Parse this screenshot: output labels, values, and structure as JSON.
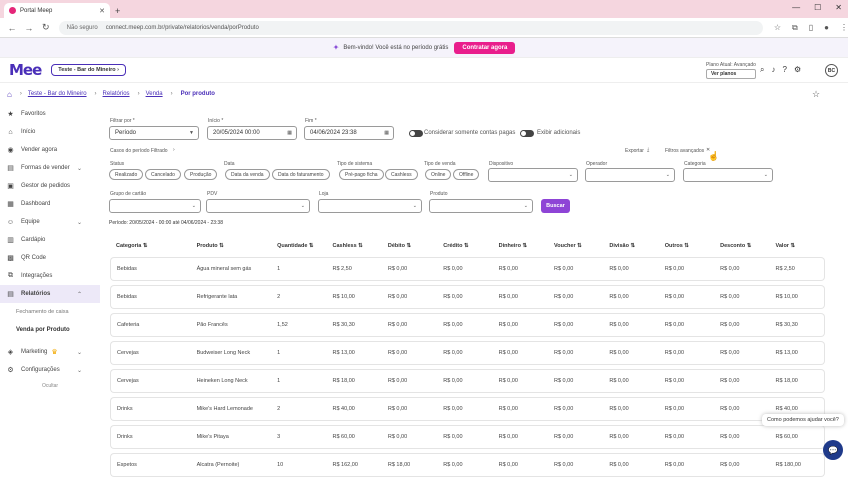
{
  "browser": {
    "tab_title": "Portal Meep",
    "new_tab": "+",
    "url_security": "Não seguro",
    "url": "connect.meep.com.br/private/relatorios/venda/porProduto"
  },
  "promo": {
    "text": "Bem-vindo! Você está no período grátis",
    "cta": "Contratar agora"
  },
  "app": {
    "logo": "Mee",
    "venue": "Teste - Bar do Mineiro",
    "plan_label": "Plano Atual: Avançado",
    "plan_button": "Ver planos",
    "avatar": "BC"
  },
  "breadcrumb": {
    "items": [
      "Teste - Bar do Mineiro",
      "Relatórios",
      "Venda"
    ],
    "current": "Por produto"
  },
  "sidebar": {
    "items": [
      {
        "label": "Favoritos",
        "icon": "★",
        "chevron": ""
      },
      {
        "label": "Início",
        "icon": "⌂",
        "chevron": ""
      },
      {
        "label": "Vender agora",
        "icon": "◉",
        "chevron": ""
      },
      {
        "label": "Formas de vender",
        "icon": "▤",
        "chevron": "⌄"
      },
      {
        "label": "Gestor de pedidos",
        "icon": "▣",
        "chevron": ""
      },
      {
        "label": "Dashboard",
        "icon": "▦",
        "chevron": ""
      },
      {
        "label": "Equipe",
        "icon": "☺",
        "chevron": "⌄"
      },
      {
        "label": "Cardápio",
        "icon": "▥",
        "chevron": ""
      },
      {
        "label": "QR Code",
        "icon": "▩",
        "chevron": ""
      },
      {
        "label": "Integrações",
        "icon": "⧉",
        "chevron": ""
      },
      {
        "label": "Relatórios",
        "icon": "▤",
        "chevron": "⌃"
      }
    ],
    "sub_items": [
      "Fechamento de caixa",
      "Venda por Produto"
    ],
    "bottom_items": [
      {
        "label": "Marketing",
        "icon": "◈",
        "chevron": "⌄"
      },
      {
        "label": "Configurações",
        "icon": "⚙",
        "chevron": "⌄"
      }
    ],
    "hide_label": "Ocultar"
  },
  "filters": {
    "filtrar_por_label": "Filtrar por *",
    "filtrar_por_value": "Período",
    "inicio_label": "Início *",
    "inicio_value": "20/05/2024 00:00",
    "fim_label": "Fim *",
    "fim_value": "04/06/2024 23:38",
    "toggle_pagas": "Considerar somente contas pagas",
    "toggle_adicionais": "Exibir adicionais",
    "period_cases": "Casos do período Filtrado",
    "exportar": "Exportar",
    "filtros_avancados": "Filtros avançados",
    "status_label": "Status",
    "status_chips": [
      "Realizado",
      "Cancelado",
      "Produção"
    ],
    "data_label": "Data",
    "data_chips": [
      "Data da venda",
      "Data do faturamento"
    ],
    "tipo_sistema_label": "Tipo de sistema",
    "tipo_sistema_chips": [
      "Pré-pago ficha",
      "Cashless"
    ],
    "tipo_venda_label": "Tipo de venda",
    "tipo_venda_chips": [
      "Online",
      "Offline"
    ],
    "dispositivo_label": "Dispositivo",
    "operador_label": "Operador",
    "categoria_label": "Categoria",
    "grupo_label": "Grupo de cartão",
    "pdv_label": "PDV",
    "loja_label": "Loja",
    "produto_label": "Produto",
    "buscar": "Buscar",
    "period_text": "Período: 20/05/2024 - 00:00 até 04/06/2024 - 23:38"
  },
  "table": {
    "headers": [
      "Categoria ⇅",
      "Produto ⇅",
      "Quantidade ⇅",
      "Cashless ⇅",
      "Débito ⇅",
      "Crédito ⇅",
      "Dinheiro ⇅",
      "Voucher ⇅",
      "Divisão ⇅",
      "Outros ⇅",
      "Desconto ⇅",
      "Valor ⇅"
    ],
    "rows": [
      [
        "Bebidas",
        "Água mineral sem gás",
        "1",
        "R$ 2,50",
        "R$ 0,00",
        "R$ 0,00",
        "R$ 0,00",
        "R$ 0,00",
        "R$ 0,00",
        "R$ 0,00",
        "R$ 0,00",
        "R$ 2,50"
      ],
      [
        "Bebidas",
        "Refrigerante lata",
        "2",
        "R$ 10,00",
        "R$ 0,00",
        "R$ 0,00",
        "R$ 0,00",
        "R$ 0,00",
        "R$ 0,00",
        "R$ 0,00",
        "R$ 0,00",
        "R$ 10,00"
      ],
      [
        "Cafeteria",
        "Pão Francês",
        "1,52",
        "R$ 30,30",
        "R$ 0,00",
        "R$ 0,00",
        "R$ 0,00",
        "R$ 0,00",
        "R$ 0,00",
        "R$ 0,00",
        "R$ 0,00",
        "R$ 30,30"
      ],
      [
        "Cervejas",
        "Budweiser Long Neck",
        "1",
        "R$ 13,00",
        "R$ 0,00",
        "R$ 0,00",
        "R$ 0,00",
        "R$ 0,00",
        "R$ 0,00",
        "R$ 0,00",
        "R$ 0,00",
        "R$ 13,00"
      ],
      [
        "Cervejas",
        "Heineken Long Neck",
        "1",
        "R$ 18,00",
        "R$ 0,00",
        "R$ 0,00",
        "R$ 0,00",
        "R$ 0,00",
        "R$ 0,00",
        "R$ 0,00",
        "R$ 0,00",
        "R$ 18,00"
      ],
      [
        "Drinks",
        "Mike's Hard Lemonade",
        "2",
        "R$ 40,00",
        "R$ 0,00",
        "R$ 0,00",
        "R$ 0,00",
        "R$ 0,00",
        "R$ 0,00",
        "R$ 0,00",
        "R$ 0,00",
        "R$ 40,00"
      ],
      [
        "Drinks",
        "Mike's Pitaya",
        "3",
        "R$ 60,00",
        "R$ 0,00",
        "R$ 0,00",
        "R$ 0,00",
        "R$ 0,00",
        "R$ 0,00",
        "R$ 0,00",
        "R$ 0,00",
        "R$ 60,00"
      ],
      [
        "Espetos",
        "Alcatra (Pernoite)",
        "10",
        "R$ 162,00",
        "R$ 18,00",
        "R$ 0,00",
        "R$ 0,00",
        "R$ 0,00",
        "R$ 0,00",
        "R$ 0,00",
        "R$ 0,00",
        "R$ 180,00"
      ]
    ]
  },
  "chat": {
    "bubble": "Como podemos ajudar você?",
    "button": "💬"
  },
  "colors": {
    "accent": "#4a2fb8",
    "cta": "#e91e8c",
    "buscar": "#8e44d6"
  }
}
